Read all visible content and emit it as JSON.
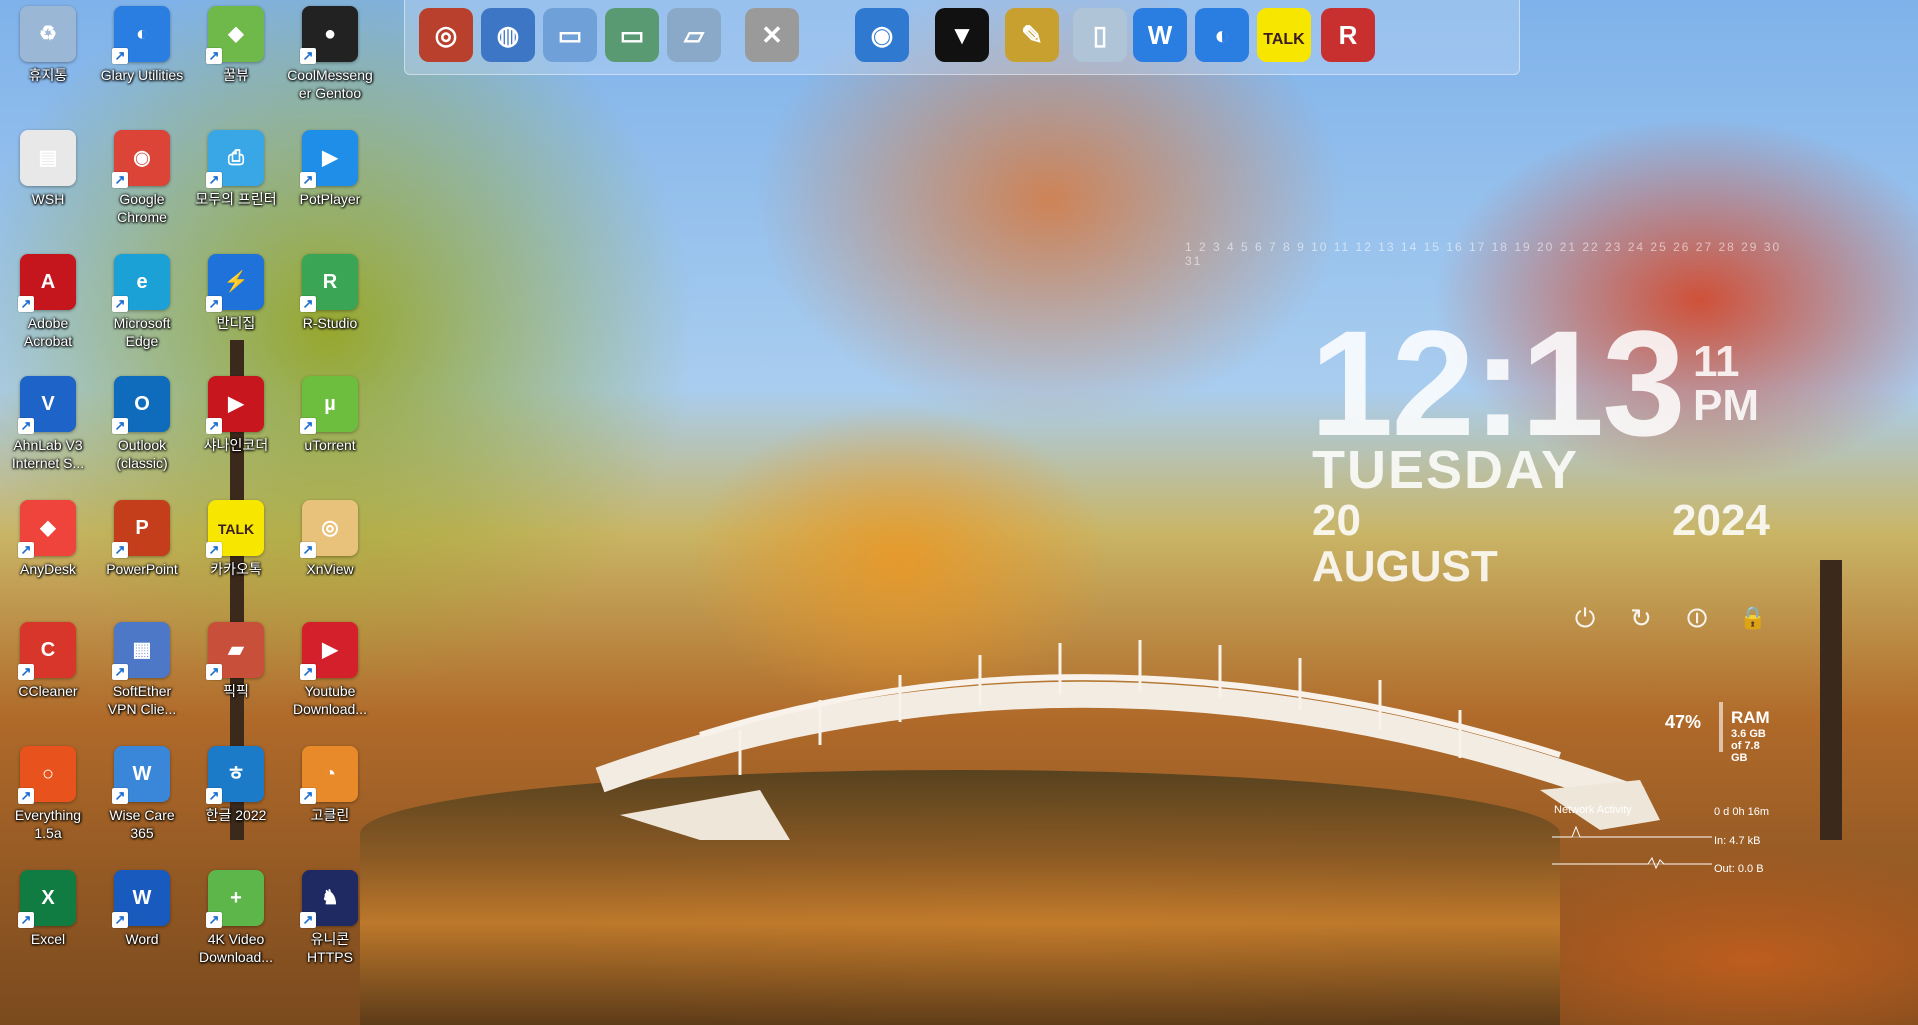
{
  "desktop": {
    "icons": [
      {
        "label": "휴지통",
        "icon": "recycle-bin-icon",
        "color": "#9ab8d6",
        "glyph": "♻"
      },
      {
        "label": "Glary Utilities",
        "icon": "glary-utilities-icon",
        "color": "#2a7de1",
        "glyph": "◐"
      },
      {
        "label": "꿀뷰",
        "icon": "honeyview-icon",
        "color": "#6fb84a",
        "glyph": "◆"
      },
      {
        "label": "CoolMessenger Gentoo",
        "icon": "penguin-icon",
        "color": "#222222",
        "glyph": "●"
      },
      {
        "label": "WSH",
        "icon": "blank-file-icon",
        "color": "#e8e8e8",
        "glyph": "▤"
      },
      {
        "label": "Google Chrome",
        "icon": "chrome-icon",
        "color": "#db4437",
        "glyph": "◉"
      },
      {
        "label": "모두의 프린터",
        "icon": "printer-icon",
        "color": "#39a6e6",
        "glyph": "⎙"
      },
      {
        "label": "PotPlayer",
        "icon": "potplayer-icon",
        "color": "#1f8ee9",
        "glyph": "▶"
      },
      {
        "label": "Adobe Acrobat",
        "icon": "acrobat-icon",
        "color": "#c4161c",
        "glyph": "A"
      },
      {
        "label": "Microsoft Edge",
        "icon": "edge-icon",
        "color": "#1ba1d6",
        "glyph": "e"
      },
      {
        "label": "반디집",
        "icon": "bandizip-icon",
        "color": "#1f72d9",
        "glyph": "⚡"
      },
      {
        "label": "R-Studio",
        "icon": "r-studio-icon",
        "color": "#3aa655",
        "glyph": "R"
      },
      {
        "label": "AhnLab V3 Internet S...",
        "icon": "ahnlab-icon",
        "color": "#1e63c8",
        "glyph": "V"
      },
      {
        "label": "Outlook (classic)",
        "icon": "outlook-icon",
        "color": "#0f6cbd",
        "glyph": "O"
      },
      {
        "label": "샤나인코더",
        "icon": "shana-encoder-icon",
        "color": "#c8161e",
        "glyph": "▶"
      },
      {
        "label": "uTorrent",
        "icon": "utorrent-icon",
        "color": "#6dbd3e",
        "glyph": "µ"
      },
      {
        "label": "AnyDesk",
        "icon": "anydesk-icon",
        "color": "#ef443b",
        "glyph": "◆"
      },
      {
        "label": "PowerPoint",
        "icon": "powerpoint-icon",
        "color": "#c43e1c",
        "glyph": "P"
      },
      {
        "label": "카카오톡",
        "icon": "kakaotalk-icon",
        "color": "#f7e600",
        "glyph": "TALK"
      },
      {
        "label": "XnView",
        "icon": "xnview-icon",
        "color": "#e8c27a",
        "glyph": "◎"
      },
      {
        "label": "CCleaner",
        "icon": "ccleaner-icon",
        "color": "#d9362b",
        "glyph": "C"
      },
      {
        "label": "SoftEther VPN Clie...",
        "icon": "softether-icon",
        "color": "#4d78c8",
        "glyph": "▦"
      },
      {
        "label": "픽픽",
        "icon": "picpick-icon",
        "color": "#c8503a",
        "glyph": "▰"
      },
      {
        "label": "Youtube Download...",
        "icon": "youtube-downloader-icon",
        "color": "#d3202a",
        "glyph": "▶"
      },
      {
        "label": "Everything 1.5a",
        "icon": "everything-search-icon",
        "color": "#e8531d",
        "glyph": "○"
      },
      {
        "label": "Wise Care 365",
        "icon": "wise-care-icon",
        "color": "#3a86d8",
        "glyph": "W"
      },
      {
        "label": "한글 2022",
        "icon": "hangul-icon",
        "color": "#1b7bc9",
        "glyph": "ㅎ"
      },
      {
        "label": "고클린",
        "icon": "goclean-icon",
        "color": "#e88a2a",
        "glyph": "◔"
      },
      {
        "label": "Excel",
        "icon": "excel-icon",
        "color": "#107c41",
        "glyph": "X"
      },
      {
        "label": "Word",
        "icon": "word-icon",
        "color": "#185abd",
        "glyph": "W"
      },
      {
        "label": "4K Video Download...",
        "icon": "4k-downloader-icon",
        "color": "#5cb64a",
        "glyph": "+"
      },
      {
        "label": "유니콘 HTTPS",
        "icon": "unicorn-https-icon",
        "color": "#1f2a63",
        "glyph": "♞"
      }
    ]
  },
  "dock": {
    "items": [
      {
        "icon": "cd-player-icon",
        "color": "#b8402c",
        "glyph": "◎"
      },
      {
        "icon": "globe-documents-icon",
        "color": "#3c76c4",
        "glyph": "◍"
      },
      {
        "icon": "folder-icon",
        "color": "#6fa0d8",
        "glyph": "▭"
      },
      {
        "icon": "folder-green-icon",
        "color": "#5a9a72",
        "glyph": "▭"
      },
      {
        "icon": "open-folder-icon",
        "color": "#8aa8c8",
        "glyph": "▱"
      },
      {
        "icon": "tools-hammer-wrench-icon",
        "color": "#9a9a9a",
        "glyph": "✕"
      },
      {
        "icon": "globe-icon",
        "color": "#2f7ad0",
        "glyph": "◉"
      },
      {
        "icon": "tshirt-icon",
        "color": "#111111",
        "glyph": "▼"
      },
      {
        "icon": "hammer-spark-icon",
        "color": "#c8a030",
        "glyph": "✎"
      },
      {
        "icon": "trash-can-icon",
        "color": "#b0c4d8",
        "glyph": "▯"
      },
      {
        "icon": "wise-shield-icon",
        "color": "#2a7de1",
        "glyph": "W"
      },
      {
        "icon": "glary-crescent-icon",
        "color": "#2a7de1",
        "glyph": "◐"
      },
      {
        "icon": "kakaotalk-dock-icon",
        "color": "#f7e600",
        "glyph": "TALK"
      },
      {
        "icon": "r-studio-dock-icon",
        "color": "#c83030",
        "glyph": "R"
      }
    ]
  },
  "clock": {
    "strip": "1 2 3 4 5 6 7 8 9 10 11 12 13 14 15 16 17 18 19 20 21 22 23 24 25 26 27 28 29 30 31",
    "time": "12:13",
    "seconds": "11",
    "ampm": "PM",
    "weekday": "TUESDAY",
    "day_month": "20 AUGUST",
    "year": "2024"
  },
  "power": [
    {
      "icon": "power-timer-icon",
      "glyph": "⏻"
    },
    {
      "icon": "restart-icon",
      "glyph": "↻"
    },
    {
      "icon": "shutdown-icon",
      "glyph": "⏼"
    },
    {
      "icon": "lock-icon",
      "glyph": "🔒"
    }
  ],
  "ram": {
    "percent": "47%",
    "label": "RAM",
    "used": "3.6 GB",
    "total": "of 7.8 GB"
  },
  "network": {
    "title": "Network Activity",
    "uptime": "0 d 0h 16m",
    "in": "In: 4.7 kB",
    "out": "Out: 0.0 B"
  }
}
